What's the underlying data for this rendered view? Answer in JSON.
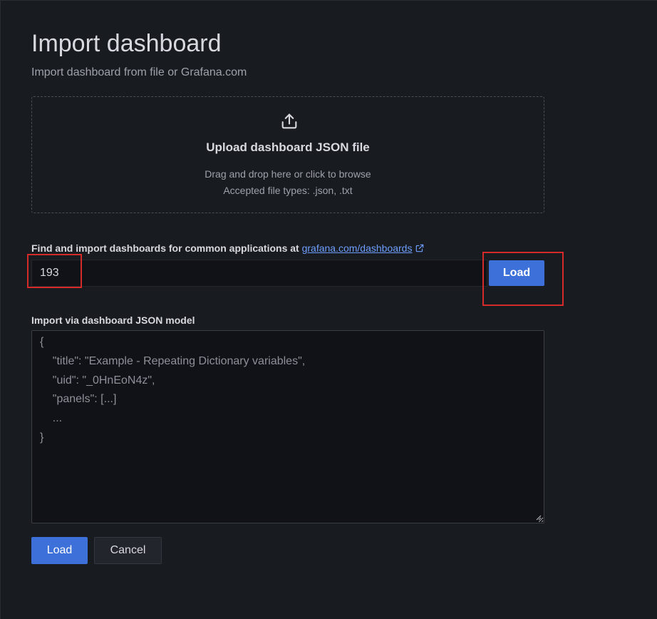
{
  "header": {
    "title": "Import dashboard",
    "subtitle": "Import dashboard from file or Grafana.com"
  },
  "upload": {
    "icon": "upload-icon",
    "title": "Upload dashboard JSON file",
    "hint_line1": "Drag and drop here or click to browse",
    "hint_line2": "Accepted file types: .json, .txt"
  },
  "grafana_com": {
    "label": "Find and import dashboards for common applications at ",
    "link_text": "grafana.com/dashboards",
    "link_icon": "external-link-icon",
    "input_value": "193",
    "load_label": "Load"
  },
  "json_model": {
    "label": "Import via dashboard JSON model",
    "placeholder": "{\n    \"title\": \"Example - Repeating Dictionary variables\",\n    \"uid\": \"_0HnEoN4z\",\n    \"panels\": [...]\n    ...\n}"
  },
  "actions": {
    "load_label": "Load",
    "cancel_label": "Cancel"
  },
  "colors": {
    "background": "#181b1f",
    "primary_button": "#3d71d9",
    "link": "#6e9fff",
    "highlight_annotation": "#d42a2a"
  }
}
